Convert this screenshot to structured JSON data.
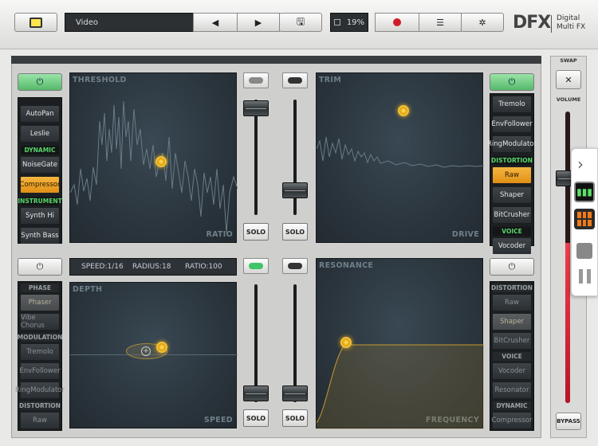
{
  "toolbar": {
    "preset_name": "Video",
    "cpu": "19%",
    "logo_main": "DFX",
    "logo_line1": "Digital",
    "logo_line2": "Multi FX"
  },
  "right_column": {
    "swap_label": "SWAP",
    "volume_label": "VOLUME",
    "bypass_label": "BYPASS",
    "volume_level_pct": 55
  },
  "module_a": {
    "pad_x_label": "RATIO",
    "pad_y_label": "THRESHOLD",
    "list": [
      {
        "type": "item",
        "label": "AutoPan"
      },
      {
        "type": "item",
        "label": "Leslie"
      },
      {
        "type": "header",
        "label": "DYNAMIC"
      },
      {
        "type": "item",
        "label": "NoiseGate"
      },
      {
        "type": "item",
        "label": "Compressor",
        "selected": true
      },
      {
        "type": "header",
        "label": "INSTRUMENT"
      },
      {
        "type": "item",
        "label": "Synth Hi"
      },
      {
        "type": "item",
        "label": "Synth Bass"
      }
    ]
  },
  "module_b": {
    "pad_x_label": "DRIVE",
    "pad_y_label": "TRIM",
    "list": [
      {
        "type": "item",
        "label": "Tremolo"
      },
      {
        "type": "item",
        "label": "EnvFollower"
      },
      {
        "type": "item",
        "label": "RingModulator"
      },
      {
        "type": "header",
        "label": "DISTORTION"
      },
      {
        "type": "item",
        "label": "Raw",
        "selected": true
      },
      {
        "type": "item",
        "label": "Shaper"
      },
      {
        "type": "item",
        "label": "BitCrusher"
      },
      {
        "type": "header",
        "label": "VOICE"
      },
      {
        "type": "item",
        "label": "Vocoder"
      }
    ]
  },
  "module_c": {
    "pad_x_label": "SPEED",
    "pad_y_label": "DEPTH",
    "info": {
      "speed": "SPEED:1/16",
      "radius": "RADIUS:18",
      "ratio": "RATIO:100"
    },
    "list": [
      {
        "type": "header",
        "label": "PHASE"
      },
      {
        "type": "item",
        "label": "Phaser",
        "selected": true
      },
      {
        "type": "item",
        "label": "Vibe Chorus"
      },
      {
        "type": "header",
        "label": "MODULATION"
      },
      {
        "type": "item",
        "label": "Tremolo"
      },
      {
        "type": "item",
        "label": "EnvFollower"
      },
      {
        "type": "item",
        "label": "RingModulator"
      },
      {
        "type": "header",
        "label": "DISTORTION"
      },
      {
        "type": "item",
        "label": "Raw"
      }
    ]
  },
  "module_d": {
    "pad_x_label": "FREQUENCY",
    "pad_y_label": "RESONANCE",
    "list": [
      {
        "type": "header",
        "label": "DISTORTION"
      },
      {
        "type": "item",
        "label": "Raw"
      },
      {
        "type": "item",
        "label": "Shaper",
        "selected": true
      },
      {
        "type": "item",
        "label": "BitCrusher"
      },
      {
        "type": "header",
        "label": "VOICE"
      },
      {
        "type": "item",
        "label": "Vocoder"
      },
      {
        "type": "item",
        "label": "Resonator"
      },
      {
        "type": "header",
        "label": "DYNAMIC"
      },
      {
        "type": "item",
        "label": "Compressor"
      }
    ]
  },
  "solo_label": "SOLO",
  "colors": {
    "accent_orange": "#f5b81c",
    "power_on_green": "#56b96b",
    "header_green": "#57d669",
    "record_red": "#d01c2a"
  }
}
